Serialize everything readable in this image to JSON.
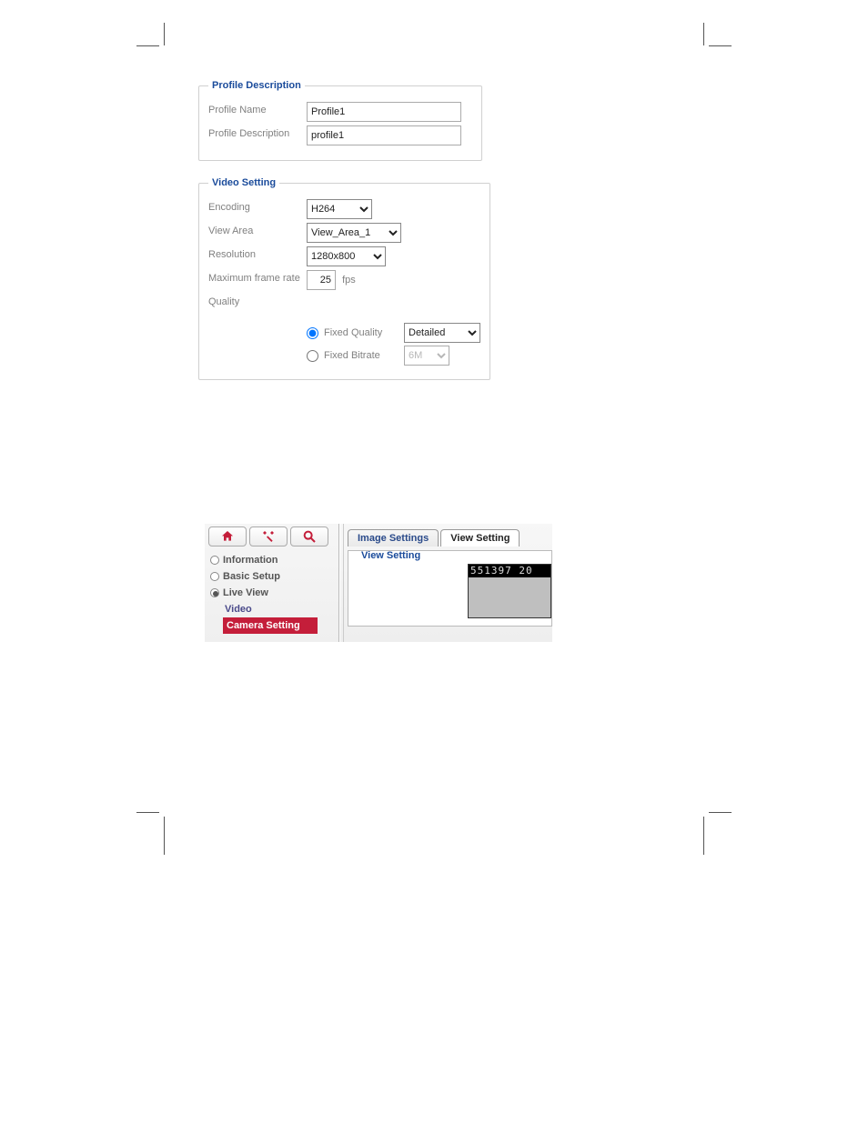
{
  "profile_panel": {
    "legend": "Profile Description",
    "name_label": "Profile Name",
    "name_value": "Profile1",
    "desc_label": "Profile Description",
    "desc_value": "profile1"
  },
  "video_panel": {
    "legend": "Video Setting",
    "encoding_label": "Encoding",
    "encoding_value": "H264",
    "viewarea_label": "View Area",
    "viewarea_value": "View_Area_1",
    "resolution_label": "Resolution",
    "resolution_value": "1280x800",
    "maxframe_label": "Maximum frame rate",
    "maxframe_value": "25",
    "fps_label": "fps",
    "quality_label": "Quality",
    "fixed_quality_label": "Fixed Quality",
    "fixed_quality_value": "Detailed",
    "fixed_bitrate_label": "Fixed Bitrate",
    "fixed_bitrate_value": "6M"
  },
  "nav": {
    "information": "Information",
    "basic_setup": "Basic Setup",
    "live_view": "Live View",
    "video": "Video",
    "camera_setting": "Camera Setting"
  },
  "tabs": {
    "image_settings": "Image Settings",
    "view_setting": "View Setting"
  },
  "view_setting_panel": {
    "legend": "View Setting",
    "overlay_text": "551397 20"
  }
}
